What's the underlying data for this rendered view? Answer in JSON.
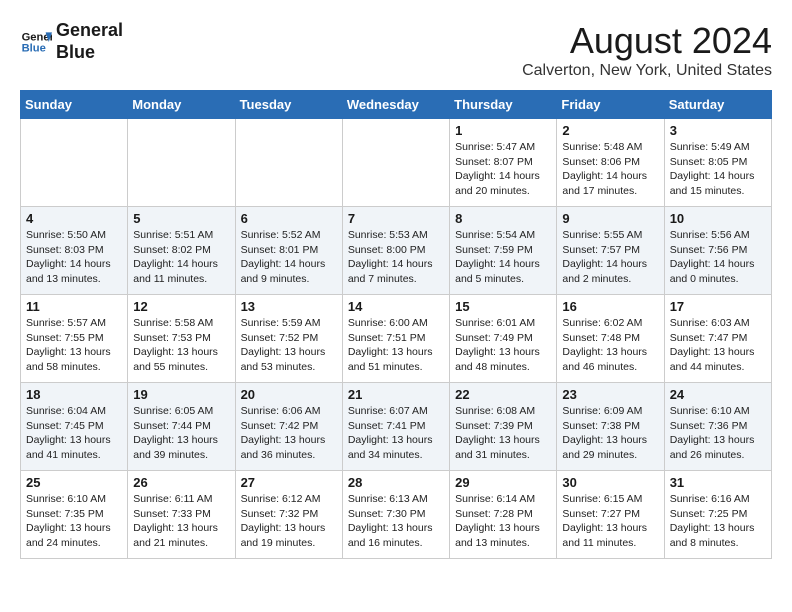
{
  "header": {
    "logo_line1": "General",
    "logo_line2": "Blue",
    "month_year": "August 2024",
    "location": "Calverton, New York, United States"
  },
  "days_of_week": [
    "Sunday",
    "Monday",
    "Tuesday",
    "Wednesday",
    "Thursday",
    "Friday",
    "Saturday"
  ],
  "weeks": [
    [
      {
        "day": "",
        "content": ""
      },
      {
        "day": "",
        "content": ""
      },
      {
        "day": "",
        "content": ""
      },
      {
        "day": "",
        "content": ""
      },
      {
        "day": "1",
        "content": "Sunrise: 5:47 AM\nSunset: 8:07 PM\nDaylight: 14 hours\nand 20 minutes."
      },
      {
        "day": "2",
        "content": "Sunrise: 5:48 AM\nSunset: 8:06 PM\nDaylight: 14 hours\nand 17 minutes."
      },
      {
        "day": "3",
        "content": "Sunrise: 5:49 AM\nSunset: 8:05 PM\nDaylight: 14 hours\nand 15 minutes."
      }
    ],
    [
      {
        "day": "4",
        "content": "Sunrise: 5:50 AM\nSunset: 8:03 PM\nDaylight: 14 hours\nand 13 minutes."
      },
      {
        "day": "5",
        "content": "Sunrise: 5:51 AM\nSunset: 8:02 PM\nDaylight: 14 hours\nand 11 minutes."
      },
      {
        "day": "6",
        "content": "Sunrise: 5:52 AM\nSunset: 8:01 PM\nDaylight: 14 hours\nand 9 minutes."
      },
      {
        "day": "7",
        "content": "Sunrise: 5:53 AM\nSunset: 8:00 PM\nDaylight: 14 hours\nand 7 minutes."
      },
      {
        "day": "8",
        "content": "Sunrise: 5:54 AM\nSunset: 7:59 PM\nDaylight: 14 hours\nand 5 minutes."
      },
      {
        "day": "9",
        "content": "Sunrise: 5:55 AM\nSunset: 7:57 PM\nDaylight: 14 hours\nand 2 minutes."
      },
      {
        "day": "10",
        "content": "Sunrise: 5:56 AM\nSunset: 7:56 PM\nDaylight: 14 hours\nand 0 minutes."
      }
    ],
    [
      {
        "day": "11",
        "content": "Sunrise: 5:57 AM\nSunset: 7:55 PM\nDaylight: 13 hours\nand 58 minutes."
      },
      {
        "day": "12",
        "content": "Sunrise: 5:58 AM\nSunset: 7:53 PM\nDaylight: 13 hours\nand 55 minutes."
      },
      {
        "day": "13",
        "content": "Sunrise: 5:59 AM\nSunset: 7:52 PM\nDaylight: 13 hours\nand 53 minutes."
      },
      {
        "day": "14",
        "content": "Sunrise: 6:00 AM\nSunset: 7:51 PM\nDaylight: 13 hours\nand 51 minutes."
      },
      {
        "day": "15",
        "content": "Sunrise: 6:01 AM\nSunset: 7:49 PM\nDaylight: 13 hours\nand 48 minutes."
      },
      {
        "day": "16",
        "content": "Sunrise: 6:02 AM\nSunset: 7:48 PM\nDaylight: 13 hours\nand 46 minutes."
      },
      {
        "day": "17",
        "content": "Sunrise: 6:03 AM\nSunset: 7:47 PM\nDaylight: 13 hours\nand 44 minutes."
      }
    ],
    [
      {
        "day": "18",
        "content": "Sunrise: 6:04 AM\nSunset: 7:45 PM\nDaylight: 13 hours\nand 41 minutes."
      },
      {
        "day": "19",
        "content": "Sunrise: 6:05 AM\nSunset: 7:44 PM\nDaylight: 13 hours\nand 39 minutes."
      },
      {
        "day": "20",
        "content": "Sunrise: 6:06 AM\nSunset: 7:42 PM\nDaylight: 13 hours\nand 36 minutes."
      },
      {
        "day": "21",
        "content": "Sunrise: 6:07 AM\nSunset: 7:41 PM\nDaylight: 13 hours\nand 34 minutes."
      },
      {
        "day": "22",
        "content": "Sunrise: 6:08 AM\nSunset: 7:39 PM\nDaylight: 13 hours\nand 31 minutes."
      },
      {
        "day": "23",
        "content": "Sunrise: 6:09 AM\nSunset: 7:38 PM\nDaylight: 13 hours\nand 29 minutes."
      },
      {
        "day": "24",
        "content": "Sunrise: 6:10 AM\nSunset: 7:36 PM\nDaylight: 13 hours\nand 26 minutes."
      }
    ],
    [
      {
        "day": "25",
        "content": "Sunrise: 6:10 AM\nSunset: 7:35 PM\nDaylight: 13 hours\nand 24 minutes."
      },
      {
        "day": "26",
        "content": "Sunrise: 6:11 AM\nSunset: 7:33 PM\nDaylight: 13 hours\nand 21 minutes."
      },
      {
        "day": "27",
        "content": "Sunrise: 6:12 AM\nSunset: 7:32 PM\nDaylight: 13 hours\nand 19 minutes."
      },
      {
        "day": "28",
        "content": "Sunrise: 6:13 AM\nSunset: 7:30 PM\nDaylight: 13 hours\nand 16 minutes."
      },
      {
        "day": "29",
        "content": "Sunrise: 6:14 AM\nSunset: 7:28 PM\nDaylight: 13 hours\nand 13 minutes."
      },
      {
        "day": "30",
        "content": "Sunrise: 6:15 AM\nSunset: 7:27 PM\nDaylight: 13 hours\nand 11 minutes."
      },
      {
        "day": "31",
        "content": "Sunrise: 6:16 AM\nSunset: 7:25 PM\nDaylight: 13 hours\nand 8 minutes."
      }
    ]
  ]
}
